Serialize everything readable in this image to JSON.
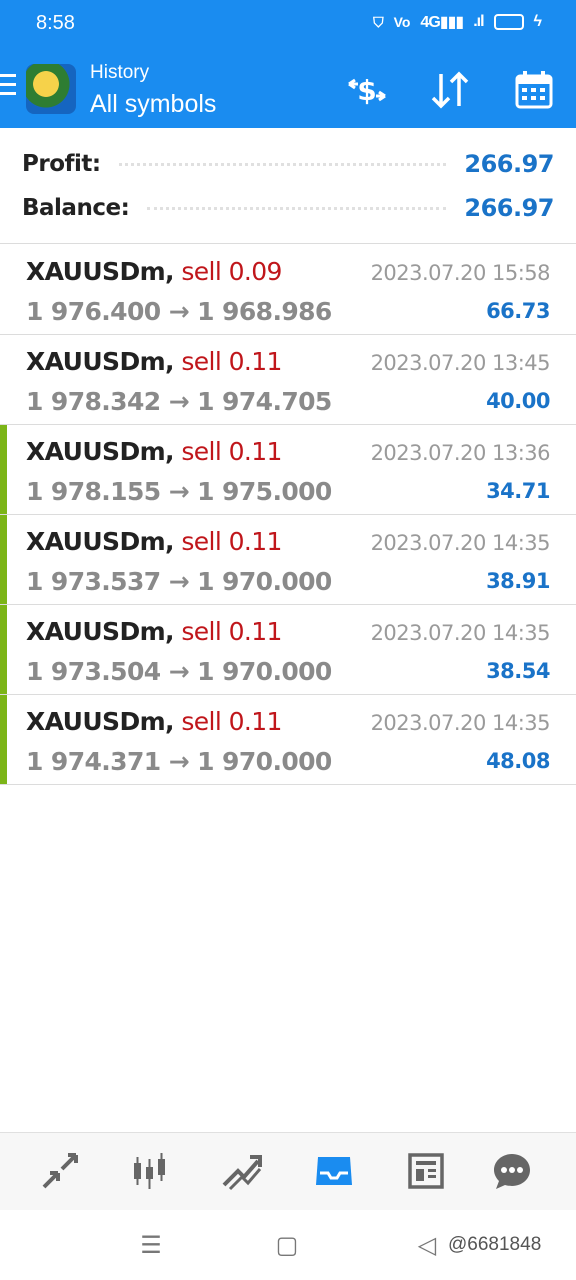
{
  "status_bar": {
    "time": "8:58",
    "network": "4G"
  },
  "app_bar": {
    "subtitle": "History",
    "title": "All symbols"
  },
  "summary": {
    "profit_label": "Profit:",
    "profit_value": "266.97",
    "balance_label": "Balance:",
    "balance_value": "266.97"
  },
  "deals": [
    {
      "symbol": "XAUUSDm,",
      "type": "sell 0.09",
      "open": "1 976.400",
      "close": "1 968.986",
      "time": "2023.07.20 15:58",
      "profit": "66.73",
      "marked": false
    },
    {
      "symbol": "XAUUSDm,",
      "type": "sell 0.11",
      "open": "1 978.342",
      "close": "1 974.705",
      "time": "2023.07.20 13:45",
      "profit": "40.00",
      "marked": false
    },
    {
      "symbol": "XAUUSDm,",
      "type": "sell 0.11",
      "open": "1 978.155",
      "close": "1 975.000",
      "time": "2023.07.20 13:36",
      "profit": "34.71",
      "marked": true
    },
    {
      "symbol": "XAUUSDm,",
      "type": "sell 0.11",
      "open": "1 973.537",
      "close": "1 970.000",
      "time": "2023.07.20 14:35",
      "profit": "38.91",
      "marked": true
    },
    {
      "symbol": "XAUUSDm,",
      "type": "sell 0.11",
      "open": "1 973.504",
      "close": "1 970.000",
      "time": "2023.07.20 14:35",
      "profit": "38.54",
      "marked": true
    },
    {
      "symbol": "XAUUSDm,",
      "type": "sell 0.11",
      "open": "1 974.371",
      "close": "1 970.000",
      "time": "2023.07.20 14:35",
      "profit": "48.08",
      "marked": true
    }
  ],
  "arrow": "→",
  "bottom_nav": [
    {
      "name": "quotes-icon",
      "active": false
    },
    {
      "name": "chart-icon",
      "active": false
    },
    {
      "name": "trade-icon",
      "active": false
    },
    {
      "name": "history-icon",
      "active": true
    },
    {
      "name": "news-icon",
      "active": false
    },
    {
      "name": "messages-icon",
      "active": false
    }
  ],
  "colors": {
    "primary": "#1a8cf0",
    "profit": "#1a73c8",
    "sell": "#c0161b",
    "marker": "#7cb518"
  },
  "watermark": "@6681848"
}
